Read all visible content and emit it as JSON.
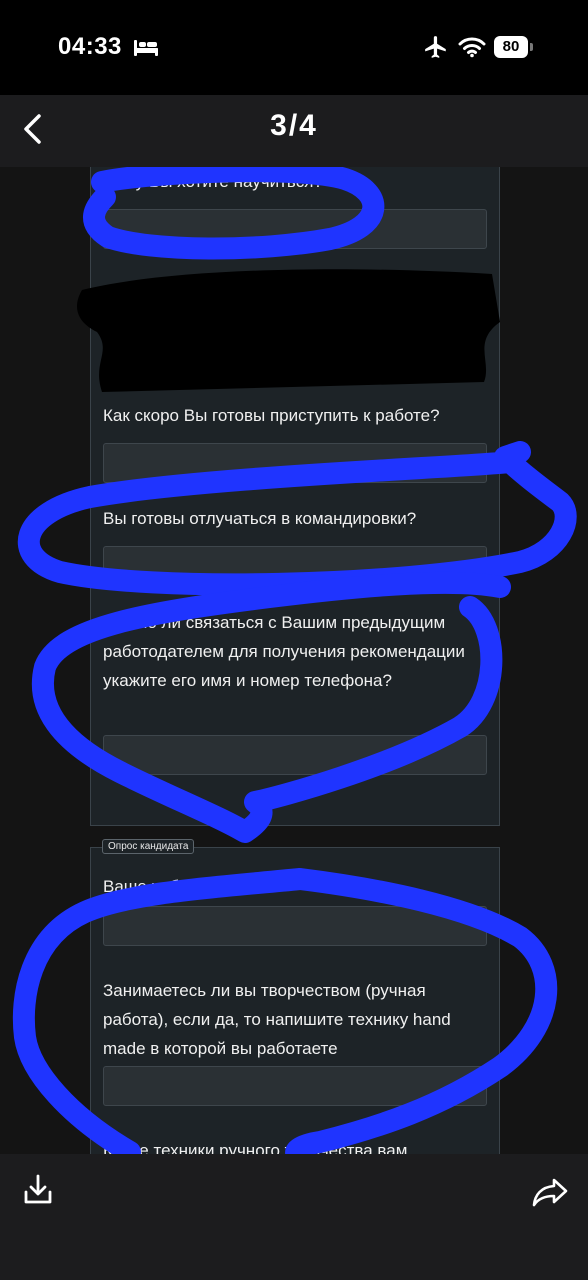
{
  "status_bar": {
    "time": "04:33",
    "battery": "80",
    "icons": [
      "bed-icon",
      "airplane-icon",
      "wifi-icon",
      "battery-icon"
    ]
  },
  "nav": {
    "title": "3/4",
    "back_icon": "chevron-left-icon"
  },
  "form": {
    "section1": {
      "fields": [
        {
          "label": "Чему Вы хотите научиться?",
          "value": ""
        },
        {
          "label": "Как скоро Вы готовы приступить к работе?",
          "value": ""
        },
        {
          "label": "Вы готовы отлучаться в командировки?",
          "value": ""
        },
        {
          "label": "Можно ли связаться с Вашим предыдущим работодателем для получения рекомендации укажите его имя и номер телефона?",
          "value": ""
        }
      ]
    },
    "section2": {
      "tag": "Опрос кандидата",
      "fields": [
        {
          "label": "Ваше хобби",
          "value": ""
        },
        {
          "label": "Занимаетесь ли вы творчеством (ручная работа), если да, то напишите технику hand made в которой вы работаете",
          "value": ""
        },
        {
          "label": "Какие техники ручного творчества вам",
          "value": ""
        }
      ]
    }
  },
  "annotation_color": "#1f34ff",
  "bottom_bar": {
    "icons": [
      "save-download-icon",
      "share-icon"
    ]
  }
}
